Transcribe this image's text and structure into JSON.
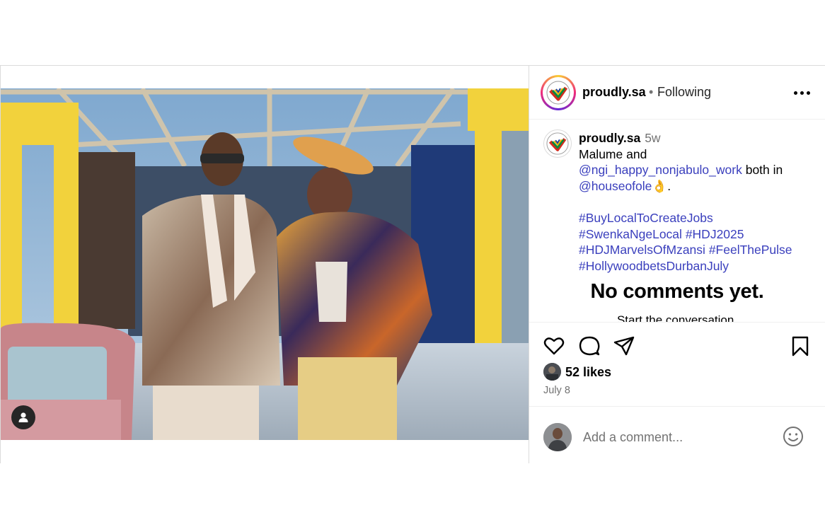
{
  "post": {
    "username": "proudly.sa",
    "follow_status": "Following",
    "separator": "•"
  },
  "caption": {
    "username": "proudly.sa",
    "time": "5w",
    "line1": "Malume and",
    "mention1": "@ngi_happy_nonjabulo_work",
    "line2_suffix": " both in",
    "mention2": "@houseofole",
    "emoji": "👌",
    "period": ".",
    "hashtags": {
      "h1": "#BuyLocalToCreateJobs",
      "h2": "#SwenkaNgeLocal",
      "h3": "#HDJ2025",
      "h4": "#HDJMarvelsOfMzansi",
      "h5": "#FeelThePulse",
      "h6": "#HollywoodbetsDurbanJuly"
    },
    "link_color": "#3a3fbd"
  },
  "comments": {
    "empty_title": "No comments yet.",
    "empty_subtitle": "Start the conversation."
  },
  "engagement": {
    "likes": "52 likes",
    "date": "July 8"
  },
  "comment_input": {
    "placeholder": "Add a comment..."
  },
  "icons": {
    "like": "heart-icon",
    "comment": "comment-bubble-icon",
    "share": "paper-plane-icon",
    "save": "bookmark-icon",
    "more": "more-options-icon",
    "emoji": "emoji-smile-icon",
    "tag": "user-tag-icon"
  }
}
